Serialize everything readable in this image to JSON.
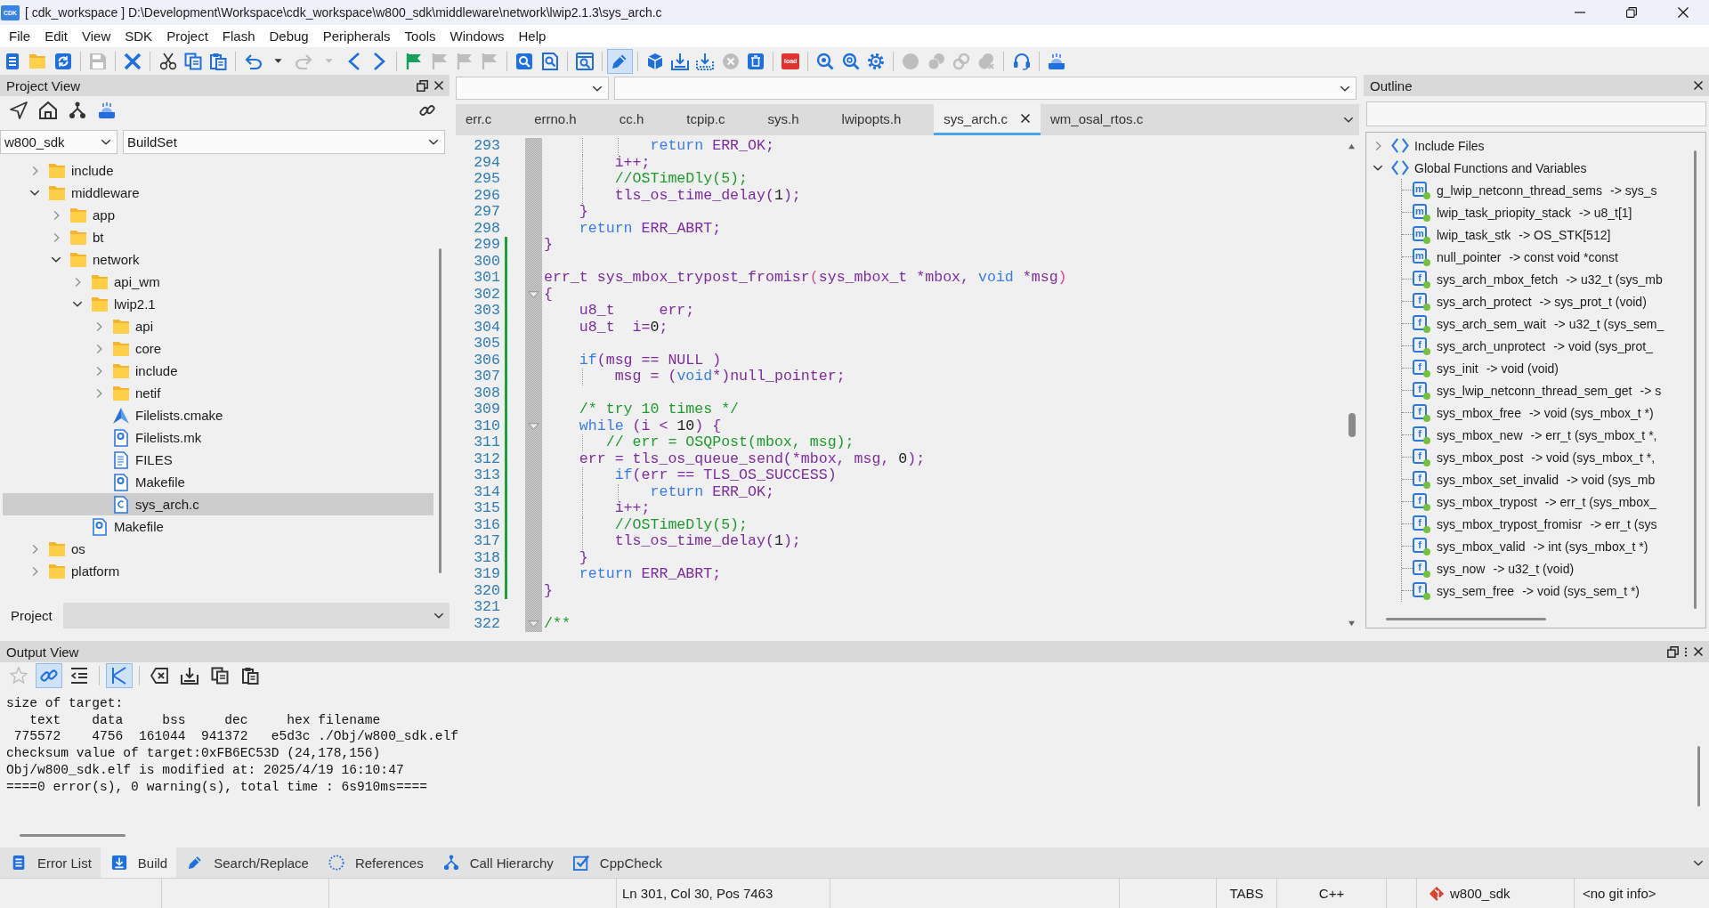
{
  "window": {
    "logo": "CDK",
    "title": "[ cdk_workspace ] D:\\Development\\Workspace\\cdk_workspace\\w800_sdk\\middleware\\network\\lwip2.1.3\\sys_arch.c"
  },
  "menu": [
    "File",
    "Edit",
    "View",
    "SDK",
    "Project",
    "Flash",
    "Debug",
    "Peripherals",
    "Tools",
    "Windows",
    "Help"
  ],
  "toolbar": [
    [
      {
        "disabled": false,
        "pressed": false
      },
      {
        "disabled": false,
        "pressed": false
      },
      {
        "disabled": false,
        "pressed": false
      }
    ],
    [
      {
        "disabled": true,
        "pressed": false
      }
    ],
    [
      {
        "disabled": false,
        "pressed": false
      }
    ],
    [
      {
        "disabled": false,
        "pressed": false
      },
      {
        "disabled": false,
        "pressed": false
      },
      {
        "disabled": false,
        "pressed": false
      }
    ],
    [
      {
        "disabled": false,
        "pressed": false
      },
      {
        "disabled": false,
        "pressed": false
      },
      {
        "disabled": true,
        "pressed": false
      },
      {
        "disabled": true,
        "pressed": false
      },
      {
        "disabled": false,
        "pressed": false
      },
      {
        "disabled": false,
        "pressed": false
      }
    ],
    [
      {
        "disabled": false,
        "pressed": false
      },
      {
        "disabled": true,
        "pressed": false
      },
      {
        "disabled": true,
        "pressed": false
      },
      {
        "disabled": true,
        "pressed": false
      }
    ],
    [
      {
        "disabled": false,
        "pressed": false
      },
      {
        "disabled": false,
        "pressed": false
      }
    ],
    [
      {
        "disabled": false,
        "pressed": false
      }
    ],
    [
      {
        "disabled": false,
        "pressed": true
      }
    ],
    [
      {
        "disabled": false,
        "pressed": false
      },
      {
        "disabled": false,
        "pressed": false
      },
      {
        "disabled": false,
        "pressed": false
      },
      {
        "disabled": true,
        "pressed": false
      },
      {
        "disabled": false,
        "pressed": false
      }
    ],
    [
      {
        "disabled": false,
        "pressed": false,
        "label": "load"
      }
    ],
    [
      {
        "disabled": false,
        "pressed": false
      },
      {
        "disabled": false,
        "pressed": false
      },
      {
        "disabled": false,
        "pressed": false
      }
    ],
    [
      {
        "disabled": true,
        "pressed": false
      },
      {
        "disabled": true,
        "pressed": false
      },
      {
        "disabled": true,
        "pressed": false
      },
      {
        "disabled": true,
        "pressed": false
      }
    ],
    [
      {
        "disabled": false,
        "pressed": false
      }
    ],
    [
      {
        "disabled": false,
        "pressed": false
      }
    ]
  ],
  "project_view": {
    "title": "Project View",
    "target": "w800_sdk",
    "build_set": "BuildSet",
    "tree": [
      {
        "label": "include",
        "kind": "folder",
        "expanded": false,
        "selected": false
      },
      {
        "label": "middleware",
        "kind": "folder",
        "expanded": true,
        "selected": false,
        "children": [
          {
            "label": "app",
            "kind": "folder",
            "expanded": false,
            "selected": false
          },
          {
            "label": "bt",
            "kind": "folder",
            "expanded": false,
            "selected": false
          },
          {
            "label": "network",
            "kind": "folder",
            "expanded": true,
            "selected": false,
            "children": [
              {
                "label": "api_wm",
                "kind": "folder",
                "expanded": false,
                "selected": false
              },
              {
                "label": "lwip2.1",
                "kind": "folder",
                "expanded": true,
                "selected": false,
                "children": [
                  {
                    "label": "api",
                    "kind": "folder",
                    "expanded": false,
                    "selected": false
                  },
                  {
                    "label": "core",
                    "kind": "folder",
                    "expanded": false,
                    "selected": false
                  },
                  {
                    "label": "include",
                    "kind": "folder",
                    "expanded": false,
                    "selected": false
                  },
                  {
                    "label": "netif",
                    "kind": "folder",
                    "expanded": false,
                    "selected": false
                  },
                  {
                    "label": "Filelists.cmake",
                    "kind": "cmake",
                    "selected": false
                  },
                  {
                    "label": "Filelists.mk",
                    "kind": "makefile",
                    "selected": false
                  },
                  {
                    "label": "FILES",
                    "kind": "text",
                    "selected": false
                  },
                  {
                    "label": "Makefile",
                    "kind": "makefile",
                    "selected": false
                  },
                  {
                    "label": "sys_arch.c",
                    "kind": "source",
                    "selected": true
                  }
                ]
              },
              {
                "label": "Makefile",
                "kind": "makefile",
                "selected": false
              }
            ]
          }
        ]
      },
      {
        "label": "os",
        "kind": "folder",
        "expanded": false,
        "selected": false
      },
      {
        "label": "platform",
        "kind": "folder",
        "expanded": false,
        "selected": false
      }
    ],
    "tabs": [
      {
        "label": "Project",
        "selected": true
      }
    ]
  },
  "editor": {
    "tabs": [
      {
        "label": "err.c",
        "selected": false
      },
      {
        "label": "errno.h",
        "selected": false
      },
      {
        "label": "cc.h",
        "selected": false
      },
      {
        "label": "tcpip.c",
        "selected": false
      },
      {
        "label": "sys.h",
        "selected": false
      },
      {
        "label": "lwipopts.h",
        "selected": false
      },
      {
        "label": "sys_arch.c",
        "selected": true
      },
      {
        "label": "wm_osal_rtos.c",
        "selected": false
      }
    ],
    "lines": [
      {
        "number": "293",
        "changed": false,
        "fold": false,
        "tokens": [
          {
            "kind": "keyword",
            "text": "            return"
          },
          {
            "kind": "text",
            "text": " ERR_OK;"
          }
        ]
      },
      {
        "number": "294",
        "changed": false,
        "fold": false,
        "tokens": [
          {
            "kind": "text",
            "text": "        i++;"
          }
        ]
      },
      {
        "number": "295",
        "changed": false,
        "fold": false,
        "tokens": [
          {
            "kind": "comment",
            "text": "        //OSTimeDly(5);"
          }
        ]
      },
      {
        "number": "296",
        "changed": false,
        "fold": false,
        "tokens": [
          {
            "kind": "text",
            "text": "        tls_os_time_delay("
          },
          {
            "kind": "number",
            "text": "1"
          },
          {
            "kind": "text",
            "text": ");"
          }
        ]
      },
      {
        "number": "297",
        "changed": false,
        "fold": false,
        "tokens": [
          {
            "kind": "text",
            "text": "    }"
          }
        ]
      },
      {
        "number": "298",
        "changed": false,
        "fold": false,
        "tokens": [
          {
            "kind": "keyword",
            "text": "    return"
          },
          {
            "kind": "text",
            "text": " ERR_ABRT;"
          }
        ]
      },
      {
        "number": "299",
        "changed": true,
        "fold": false,
        "tokens": [
          {
            "kind": "text",
            "text": "}"
          }
        ]
      },
      {
        "number": "300",
        "changed": true,
        "fold": false
      },
      {
        "number": "301",
        "changed": true,
        "fold": false,
        "tokens": [
          {
            "kind": "text",
            "text": "err_t sys_mbox_trypost_fromisr"
          },
          {
            "kind": "paren",
            "text": "("
          },
          {
            "kind": "text",
            "text": "sys_mbox_t *mbox, "
          },
          {
            "kind": "keyword",
            "text": "void"
          },
          {
            "kind": "text",
            "text": " *msg"
          },
          {
            "kind": "paren",
            "text": ")"
          }
        ]
      },
      {
        "number": "302",
        "changed": true,
        "fold": true,
        "tokens": [
          {
            "kind": "text",
            "text": "{"
          }
        ]
      },
      {
        "number": "303",
        "changed": true,
        "fold": false,
        "tokens": [
          {
            "kind": "text",
            "text": "    u8_t     err;"
          }
        ]
      },
      {
        "number": "304",
        "changed": true,
        "fold": false,
        "tokens": [
          {
            "kind": "text",
            "text": "    u8_t  i="
          },
          {
            "kind": "number",
            "text": "0"
          },
          {
            "kind": "text",
            "text": ";"
          }
        ]
      },
      {
        "number": "305",
        "changed": true,
        "fold": false
      },
      {
        "number": "306",
        "changed": true,
        "fold": false,
        "tokens": [
          {
            "kind": "keyword",
            "text": "    if"
          },
          {
            "kind": "text",
            "text": "(msg == NULL )"
          }
        ]
      },
      {
        "number": "307",
        "changed": true,
        "fold": false,
        "tokens": [
          {
            "kind": "text",
            "text": "        msg = ("
          },
          {
            "kind": "keyword",
            "text": "void"
          },
          {
            "kind": "text",
            "text": "*)null_pointer;"
          }
        ]
      },
      {
        "number": "308",
        "changed": true,
        "fold": false
      },
      {
        "number": "309",
        "changed": true,
        "fold": false,
        "tokens": [
          {
            "kind": "comment",
            "text": "    /* try 10 times */"
          }
        ]
      },
      {
        "number": "310",
        "changed": true,
        "fold": true,
        "tokens": [
          {
            "kind": "keyword",
            "text": "    while"
          },
          {
            "kind": "text",
            "text": " (i < "
          },
          {
            "kind": "number",
            "text": "10"
          },
          {
            "kind": "text",
            "text": ") {"
          }
        ]
      },
      {
        "number": "311",
        "changed": true,
        "fold": false,
        "tokens": [
          {
            "kind": "comment",
            "text": "       // err = OSQPost(mbox, msg);"
          }
        ]
      },
      {
        "number": "312",
        "changed": true,
        "fold": false,
        "tokens": [
          {
            "kind": "text",
            "text": "    err = tls_os_queue_send(*mbox, msg, "
          },
          {
            "kind": "number",
            "text": "0"
          },
          {
            "kind": "text",
            "text": ");"
          }
        ]
      },
      {
        "number": "313",
        "changed": true,
        "fold": false,
        "tokens": [
          {
            "kind": "keyword",
            "text": "        if"
          },
          {
            "kind": "text",
            "text": "(err == TLS_OS_SUCCESS)"
          }
        ]
      },
      {
        "number": "314",
        "changed": true,
        "fold": false,
        "tokens": [
          {
            "kind": "keyword",
            "text": "            return"
          },
          {
            "kind": "text",
            "text": " ERR_OK;"
          }
        ]
      },
      {
        "number": "315",
        "changed": true,
        "fold": false,
        "tokens": [
          {
            "kind": "text",
            "text": "        i++;"
          }
        ]
      },
      {
        "number": "316",
        "changed": true,
        "fold": false,
        "tokens": [
          {
            "kind": "comment",
            "text": "        //OSTimeDly(5);"
          }
        ]
      },
      {
        "number": "317",
        "changed": true,
        "fold": false,
        "tokens": [
          {
            "kind": "text",
            "text": "        tls_os_time_delay("
          },
          {
            "kind": "number",
            "text": "1"
          },
          {
            "kind": "text",
            "text": ");"
          }
        ]
      },
      {
        "number": "318",
        "changed": true,
        "fold": false,
        "tokens": [
          {
            "kind": "text",
            "text": "    }"
          }
        ]
      },
      {
        "number": "319",
        "changed": true,
        "fold": false,
        "tokens": [
          {
            "kind": "keyword",
            "text": "    return"
          },
          {
            "kind": "text",
            "text": " ERR_ABRT;"
          }
        ]
      },
      {
        "number": "320",
        "changed": true,
        "fold": false,
        "tokens": [
          {
            "kind": "text",
            "text": "}"
          }
        ]
      },
      {
        "number": "321",
        "changed": false,
        "fold": false
      },
      {
        "number": "322",
        "changed": false,
        "fold": true,
        "tokens": [
          {
            "kind": "comment",
            "text": "/**"
          }
        ]
      }
    ]
  },
  "outline": {
    "title": "Outline",
    "items": [
      {
        "label": "Include Files",
        "expanded": false
      },
      {
        "label": "Global Functions and Variables",
        "expanded": true,
        "children": [
          {
            "badge": "m",
            "name": "g_lwip_netconn_thread_sems",
            "type": "-> sys_s"
          },
          {
            "badge": "m",
            "name": "lwip_task_priopity_stack",
            "type": "-> u8_t[1]"
          },
          {
            "badge": "m",
            "name": "lwip_task_stk",
            "type": "-> OS_STK[512]"
          },
          {
            "badge": "m",
            "name": "null_pointer",
            "type": "-> const void *const"
          },
          {
            "badge": "f",
            "name": "sys_arch_mbox_fetch",
            "type": "-> u32_t (sys_mb"
          },
          {
            "badge": "f",
            "name": "sys_arch_protect",
            "type": "-> sys_prot_t (void)"
          },
          {
            "badge": "f",
            "name": "sys_arch_sem_wait",
            "type": "-> u32_t (sys_sem_"
          },
          {
            "badge": "f",
            "name": "sys_arch_unprotect",
            "type": "-> void (sys_prot_"
          },
          {
            "badge": "f",
            "name": "sys_init",
            "type": "-> void (void)"
          },
          {
            "badge": "f",
            "name": "sys_lwip_netconn_thread_sem_get",
            "type": "-> s"
          },
          {
            "badge": "f",
            "name": "sys_mbox_free",
            "type": "-> void (sys_mbox_t *)"
          },
          {
            "badge": "f",
            "name": "sys_mbox_new",
            "type": "-> err_t (sys_mbox_t *,"
          },
          {
            "badge": "f",
            "name": "sys_mbox_post",
            "type": "-> void (sys_mbox_t *,"
          },
          {
            "badge": "f",
            "name": "sys_mbox_set_invalid",
            "type": "-> void (sys_mb"
          },
          {
            "badge": "f",
            "name": "sys_mbox_trypost",
            "type": "-> err_t (sys_mbox_"
          },
          {
            "badge": "f",
            "name": "sys_mbox_trypost_fromisr",
            "type": "-> err_t (sys"
          },
          {
            "badge": "f",
            "name": "sys_mbox_valid",
            "type": "-> int (sys_mbox_t *)"
          },
          {
            "badge": "f",
            "name": "sys_now",
            "type": "-> u32_t (void)"
          },
          {
            "badge": "f",
            "name": "sys_sem_free",
            "type": "-> void (sys_sem_t *)"
          }
        ]
      }
    ]
  },
  "output_view": {
    "title": "Output View",
    "toolbar": [
      [
        {
          "disabled": true,
          "pressed": false
        },
        {
          "disabled": false,
          "pressed": true
        },
        {
          "disabled": false,
          "pressed": false
        }
      ],
      [
        {
          "disabled": false,
          "pressed": true
        }
      ],
      [
        {
          "disabled": false,
          "pressed": false
        },
        {
          "disabled": false,
          "pressed": false
        },
        {
          "disabled": false,
          "pressed": false
        },
        {
          "disabled": false,
          "pressed": false
        }
      ]
    ],
    "lines": [
      "size of target:",
      "   text    data     bss     dec     hex filename",
      " 775572    4756  161044  941372   e5d3c ./Obj/w800_sdk.elf",
      "checksum value of target:0xFB6EC53D (24,178,156)",
      "Obj/w800_sdk.elf is modified at: 2025/4/19 16:10:47",
      "====0 error(s), 0 warning(s), total time : 6s910ms===="
    ]
  },
  "bottom_tabs": [
    {
      "label": "Error List",
      "selected": false
    },
    {
      "label": "Build",
      "selected": true
    },
    {
      "label": "Search/Replace",
      "selected": false
    },
    {
      "label": "References",
      "selected": false
    },
    {
      "label": "Call Hierarchy",
      "selected": false
    },
    {
      "label": "CppCheck",
      "selected": false
    }
  ],
  "status_bar": [
    {
      "kind": "plain",
      "text": "Ln 301, Col 30, Pos 7463"
    },
    {
      "kind": "plain",
      "text": "TABS"
    },
    {
      "kind": "plain",
      "text": "C++"
    },
    {
      "kind": "git",
      "text": "w800_sdk"
    },
    {
      "kind": "plain",
      "text": "<no git info>"
    }
  ]
}
